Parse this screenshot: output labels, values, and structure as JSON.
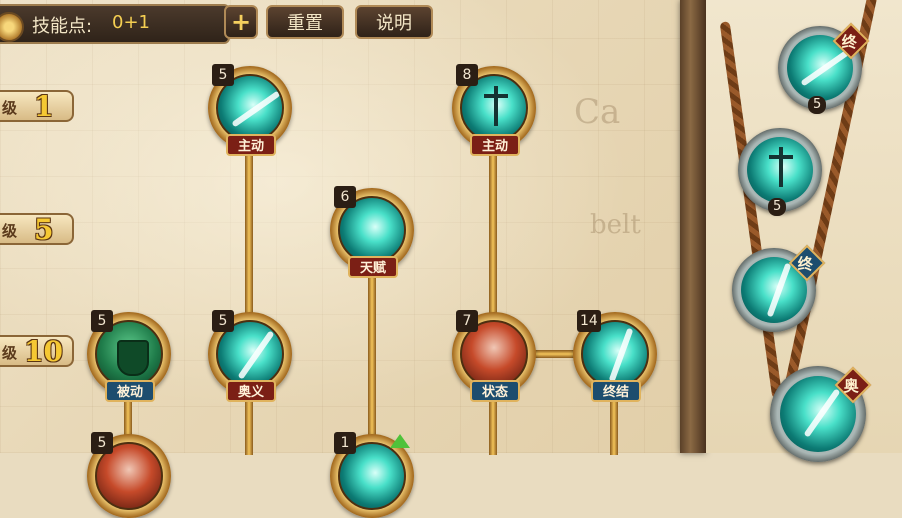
{
  "topbar": {
    "skillpoints_label": "技能点:",
    "skillpoints_value": "0+1",
    "plus_label": "+",
    "reset_label": "重置",
    "help_label": "说明"
  },
  "levels": [
    {
      "prefix": "级",
      "num": "1"
    },
    {
      "prefix": "级",
      "num": "5"
    },
    {
      "prefix": "级",
      "num": "10"
    }
  ],
  "skills": [
    {
      "level": "5",
      "tag": "主动"
    },
    {
      "level": "8",
      "tag": "主动"
    },
    {
      "level": "6",
      "tag": "天赋"
    },
    {
      "level": "5",
      "tag": "被动"
    },
    {
      "level": "5",
      "tag": "奥义"
    },
    {
      "level": "7",
      "tag": "状态"
    },
    {
      "level": "14",
      "tag": "终结"
    },
    {
      "level": "5"
    },
    {
      "level": "1"
    }
  ],
  "equipped": [
    {
      "tag": "终",
      "count": "5"
    },
    {
      "count": "5"
    },
    {
      "tag": "终"
    },
    {
      "tag": "奥"
    }
  ],
  "map_text": [
    "Ca",
    "belt"
  ],
  "colors": {
    "node_ring": "#f1c45c",
    "active_tag": "#7b1f15",
    "status_tag": "#1d4d6e",
    "skill_teal": "#49e0c9"
  }
}
